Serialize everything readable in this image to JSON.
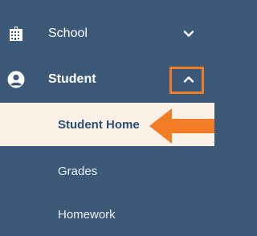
{
  "nav": {
    "school": {
      "label": "School",
      "icon": "building-icon"
    },
    "student": {
      "label": "Student",
      "icon": "user-circle-icon"
    },
    "submenu": [
      {
        "label": "Student Home"
      },
      {
        "label": "Grades"
      },
      {
        "label": "Homework"
      }
    ]
  },
  "colors": {
    "sidebar_bg": "#3c5a78",
    "active_bg": "#fbf1e6",
    "active_text": "#2a4e74",
    "highlight": "#f27d26"
  }
}
